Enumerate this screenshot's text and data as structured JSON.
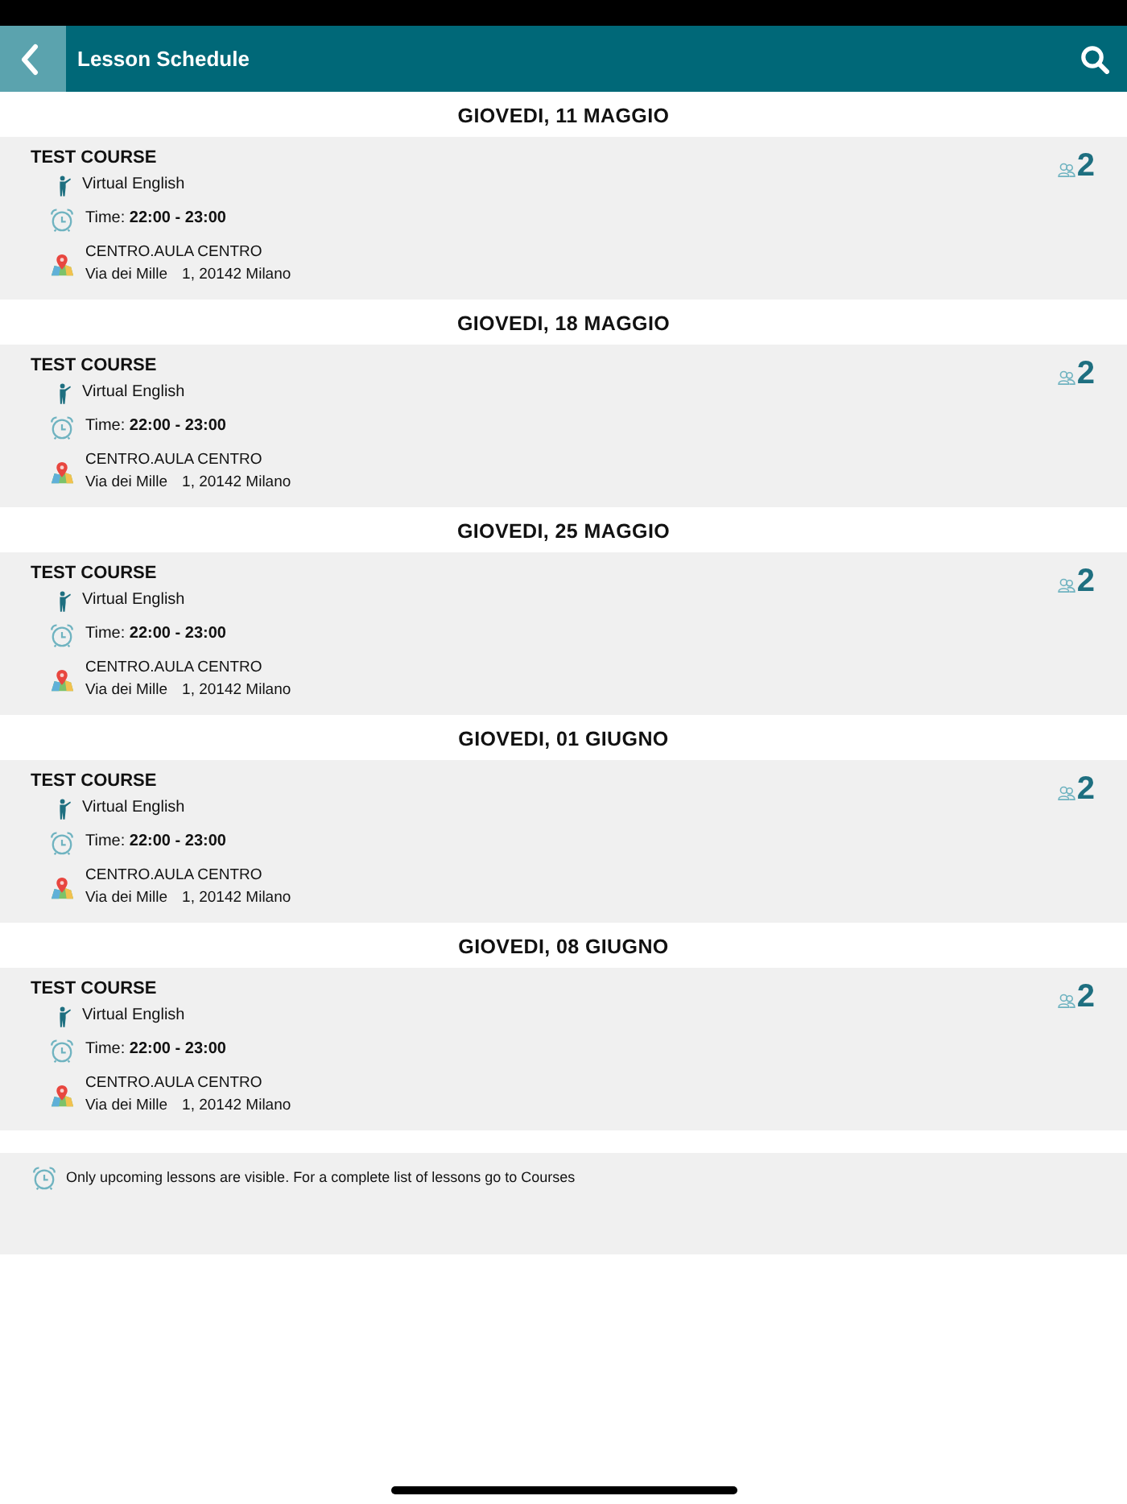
{
  "header": {
    "title": "Lesson Schedule"
  },
  "lessons": [
    {
      "date": "GIOVEDI, 11 MAGGIO",
      "course": "TEST COURSE",
      "teacher": "Virtual English",
      "time": "Time: **22:00 - 23:00**",
      "location": "CENTRO.AULA CENTRO",
      "street": "Via dei Mille",
      "city": "1, 20142 Milano",
      "participants": "2"
    },
    {
      "date": "GIOVEDI, 18 MAGGIO",
      "course": "TEST COURSE",
      "teacher": "Virtual English",
      "time": "Time: **22:00 - 23:00**",
      "location": "CENTRO.AULA CENTRO",
      "street": "Via dei Mille",
      "city": "1, 20142 Milano",
      "participants": "2"
    },
    {
      "date": "GIOVEDI, 25 MAGGIO",
      "course": "TEST COURSE",
      "teacher": "Virtual English",
      "time": "Time: **22:00 - 23:00**",
      "location": "CENTRO.AULA CENTRO",
      "street": "Via dei Mille",
      "city": "1, 20142 Milano",
      "participants": "2"
    },
    {
      "date": "GIOVEDI, 01 GIUGNO",
      "course": "TEST COURSE",
      "teacher": "Virtual English",
      "time": "Time: **22:00 - 23:00**",
      "location": "CENTRO.AULA CENTRO",
      "street": "Via dei Mille",
      "city": "1, 20142 Milano",
      "participants": "2"
    },
    {
      "date": "GIOVEDI, 08 GIUGNO",
      "course": "TEST COURSE",
      "teacher": "Virtual English",
      "time": "Time: **22:00 - 23:00**",
      "location": "CENTRO.AULA CENTRO",
      "street": "Via dei Mille",
      "city": "1, 20142 Milano",
      "participants": "2"
    }
  ],
  "note": "Only upcoming lessons are visible. For a complete list of lessons go to Courses"
}
